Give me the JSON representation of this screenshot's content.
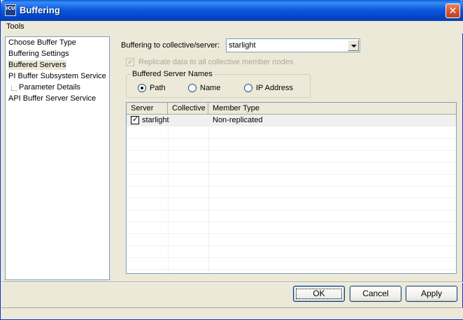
{
  "window": {
    "title": "Buffering",
    "app_icon": "icu-icon",
    "icon_text": "ICU"
  },
  "menu": {
    "items": [
      "Tools"
    ]
  },
  "tree": {
    "items": [
      {
        "label": "Choose Buffer Type"
      },
      {
        "label": "Buffering Settings"
      },
      {
        "label": "Buffered Servers",
        "selected": true
      },
      {
        "label": "PI Buffer Subsystem Service"
      },
      {
        "label": "Parameter Details"
      },
      {
        "label": "API Buffer Server Service"
      }
    ]
  },
  "buffering": {
    "target_label": "Buffering to collective/server:",
    "target_value": "starlight",
    "replicate_label": "Replicate data to all collective member nodes",
    "replicate_checked": true,
    "replicate_enabled": false
  },
  "names_group": {
    "title": "Buffered Server Names",
    "options": [
      "Path",
      "Name",
      "IP Address"
    ],
    "selected": "Path"
  },
  "grid": {
    "columns": [
      "Server",
      "Collective",
      "Member Type"
    ],
    "rows": [
      {
        "checked": true,
        "server": "starlight",
        "collective": "",
        "member_type": "Non-replicated"
      }
    ]
  },
  "buttons": {
    "ok": "OK",
    "cancel": "Cancel",
    "apply": "Apply"
  },
  "colors": {
    "titlebar": "#0346c7",
    "window_bg": "#ece9d8",
    "close_button": "#d3512c"
  }
}
